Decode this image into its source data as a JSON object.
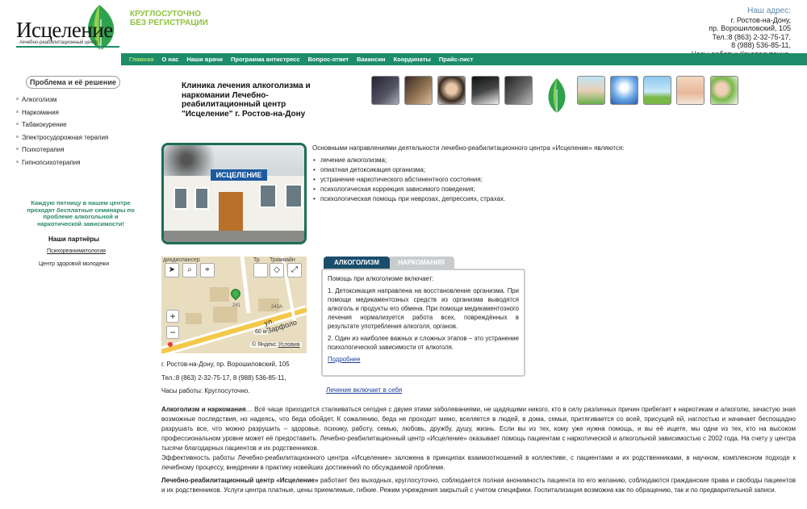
{
  "header": {
    "logo_text": "Исцеление",
    "logo_sub": "лечебно-реабилитационный центр",
    "slogan_line1": "КРУГЛОСУТОЧНО",
    "slogan_line2": "БЕЗ РЕГИСТРАЦИИ",
    "address_title": "Наш адрес:",
    "address_line1": "г. Ростов-на-Дону,",
    "address_line2": "пр. Ворошиловский, 105",
    "address_line3": "Тел.:8 (863) 2-32-75-17,",
    "address_line4": "8 (988) 536-85-11,",
    "address_line5": "Часы работы: Круглосуточно."
  },
  "nav": [
    "Главная",
    "О нас",
    "Наши врачи",
    "Программа антистресс",
    "Вопрос-ответ",
    "Вакансии",
    "Координаты",
    "Прайс-лист"
  ],
  "sidebar": {
    "title": "Проблема и её решение",
    "items": [
      "Алкоголизм",
      "Наркомания",
      "Табакокурение",
      "Электросудорожная терапия",
      "Психотерапия",
      "Гипнопсихотерапия"
    ],
    "promo": "Каждую пятницу в нашем центре проходят бесплатные семинары по проблеме алкогольной и наркотической зависимости!",
    "partners_title": "Наши партнёры",
    "partners": [
      "Психореаниматология",
      "Центр здоровой молодежи"
    ]
  },
  "main": {
    "heading": "Клиника лечения алкоголизма и наркомании Лечебно-реабилитационный центр \"Исцеление\" г. Ростов-на-Дону",
    "sign_text": "ИСЦЕЛЕНИЕ",
    "intro": "Основными направлениями деятельности лечебно-реабилитационного центра «Исцеление» являются:",
    "directions": [
      "лечение алкоголизма;",
      "опиатная детоксикация организма;",
      "устранение наркотического абстинентного состояния;",
      "психологическая коррекция зависимого поведения;",
      "психологическая помощь при неврозах, депрессиях, страхах."
    ]
  },
  "map": {
    "label_top_left": "дихдиспансер",
    "label_top_mid": "Тр",
    "label_top_right": "Трамвайн",
    "label_street": "ул. Варфоло",
    "label_241": "241",
    "label_243a": "243А",
    "scale": "60 м",
    "copyright": "© Яндекс",
    "terms": "Условия"
  },
  "contact": {
    "address": "г. Ростов-на-Дону, пр. Ворошиловский, 105",
    "phone": "Тел.:8 (863) 2-32-75-17, 8 (988) 536-85-11,",
    "hours": "Часы работы: Круглосуточно."
  },
  "tabs": {
    "tab1": "АЛКОГОЛИЗМ",
    "tab2": "НАРКОМАНИЯ",
    "intro": "Помощь при алкоголизме включает:",
    "p1": "1. Детоксикация направлена на восстановление организма. При помощи медикаментозных средств из организма выводятся алкоголь и продукты его обмена. При помощи медикаментозного лечения нормализуется работа всех, повреждённых в результате употребления алкоголя, органов.",
    "p2": "2. Один из наиболее важных и сложных этапов – это устранение психологической зависимости от алкоголя.",
    "more": "Подробнее",
    "link_below": "Лечение включает в себя"
  },
  "body": {
    "p1_bold": "Алкоголизм и наркомания",
    "p1": "… Всё чаще приходится сталкиваться сегодня с двумя этими заболеваниями, не щадящими никого, кто в силу различных причин прибегает к наркотикам и алкоголю, зачастую зная возможные последствия, но надеясь, что беда обойдет. К сожалению, беда не проходит мимо, вселяется в людей, в дома, семьи, притягивается со всей, присущей ей, наглостью и начинает беспощадно разрушать все, что можно разрушить – здоровье, психику, работу, семью, любовь, дружбу, душу, жизнь. Если вы из тех, кому уже нужна помощь, и вы её ищете, мы одни из тех, кто на высоком профессиональном уровне может её предоставить. Лечебно-реабилитационный центр «Исцеление» оказывает помощь пациентам с наркотической и алкогольной зависимостью с 2002 года. На счету у центра тысячи благодарных пациентов и их родственников.",
    "p2": "Эффективность работы Лечебно-реабилитационного центра «Исцеление» заложена в принципах взаимоотношений в коллективе, с пациентами и их родственниками, в научном, комплексном подходе к лечебному процессу, внедрении в практику новейших достижений по обсуждаемой проблеме.",
    "p3_bold": "Лечебно-реабилитационный центр «Исцеление»",
    "p3": " работает без выходных, круглосуточно, соблюдается полная анонимность пациента по его желанию, соблюдаются гражданские права и свободы пациентов и их родственников. Услуги центра платные, цены приемлемые, гибкие. Режим учреждения закрытый с учетом специфики. Госпитализация возможна как по обращению, так и по предварительной записи."
  },
  "colors": {
    "brand_green": "#1d8c6b",
    "light_green": "#8fc13e",
    "dark_teal": "#1e6e55",
    "tab_active": "#1a4d6c"
  }
}
